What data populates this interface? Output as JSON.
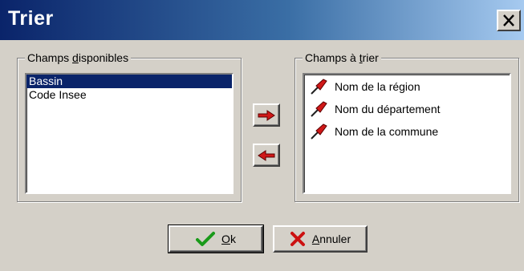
{
  "window": {
    "title": "Trier"
  },
  "available": {
    "label_before": "Champs ",
    "label_accel": "d",
    "label_after": "isponibles",
    "items": [
      "Bassin",
      "Code Insee"
    ]
  },
  "sorted": {
    "label_before": "Champs à ",
    "label_accel": "t",
    "label_after": "rier",
    "items": [
      "Nom de la région",
      "Nom du département",
      "Nom de la commune"
    ]
  },
  "buttons": {
    "ok_accel": "O",
    "ok_rest": "k",
    "cancel_accel": "A",
    "cancel_rest": "nnuler"
  },
  "icons": {
    "move_right": "arrow-right-icon",
    "move_left": "arrow-left-icon",
    "sort_field": "pin-icon",
    "ok": "checkmark-icon",
    "cancel": "cross-icon",
    "close": "close-icon"
  },
  "colors": {
    "selection": "#0a246a",
    "arrow_red": "#d01818",
    "check_green": "#1a9a1a",
    "cross_red": "#cc1111"
  }
}
